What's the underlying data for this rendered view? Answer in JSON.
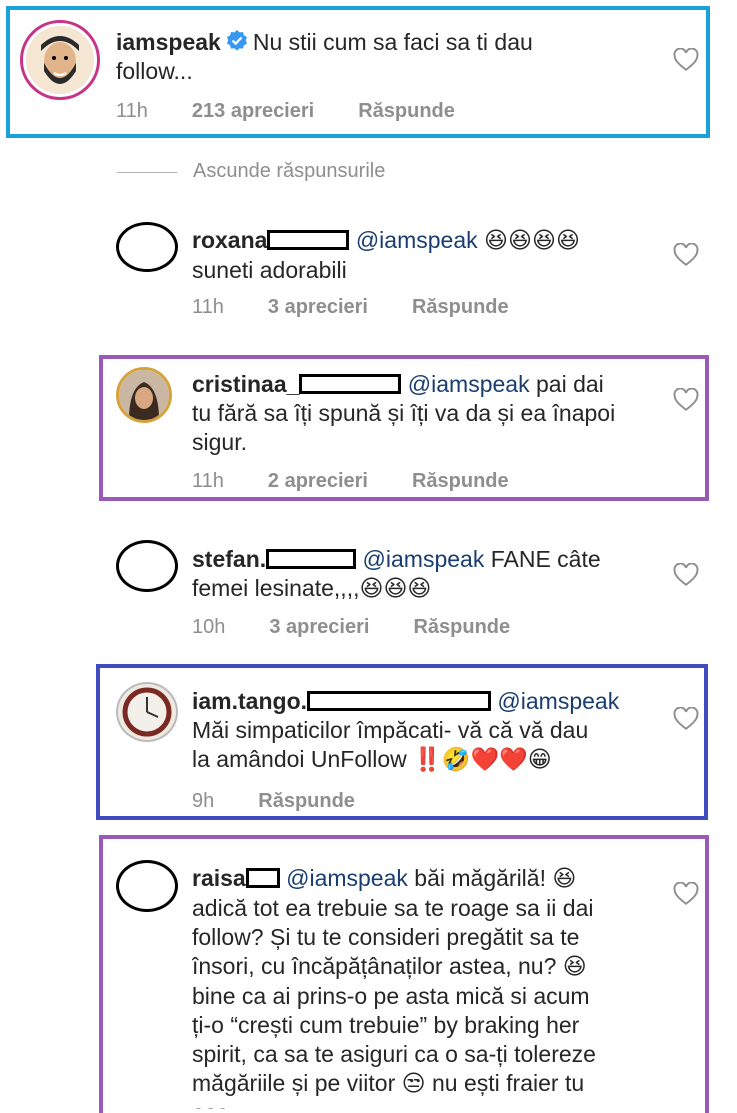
{
  "main_comment": {
    "username": "iamspeak",
    "text_line1": "Nu stii cum sa faci sa ti dau",
    "text_line2": "follow...",
    "time": "11h",
    "likes": "213 aprecieri",
    "reply_label": "Răspunde"
  },
  "hide_replies_label": "Ascunde răspunsurile",
  "replies": [
    {
      "username": "roxana",
      "mention": "@iamspeak",
      "line1_emoji": "😆😆😆😆",
      "line2": "suneti adorabili",
      "time": "11h",
      "likes": "3 aprecieri",
      "reply_label": "Răspunde"
    },
    {
      "username": "cristinaa_",
      "mention": "@iamspeak",
      "line1_text": "pai dai",
      "line2": "tu fără sa îți spună și îți va da și ea înapoi",
      "line3": "sigur.",
      "time": "11h",
      "likes": "2 aprecieri",
      "reply_label": "Răspunde"
    },
    {
      "username": "stefan.",
      "mention": "@iamspeak",
      "line1_text": "FANE câte",
      "line2": "femei lesinate,,,,",
      "line2_emoji": "😆😆😆",
      "time": "10h",
      "likes": "3 aprecieri",
      "reply_label": "Răspunde"
    },
    {
      "username": "iam.tango.",
      "mention": "@iamspeak",
      "line2": "Măi simpaticilor împăcati- vă că vă dau",
      "line3": "la amândoi UnFollow",
      "line3_emoji": "‼️🤣❤️❤️😁",
      "time": "9h",
      "reply_label": "Răspunde"
    },
    {
      "username": "raisa",
      "mention": "@iamspeak",
      "line1_text": "băi măgărilă!",
      "line1_emoji": "😆",
      "line2": "adică tot ea trebuie sa te roage sa ii dai",
      "line3": "follow? Și tu te consideri pregătit sa te",
      "line4": "însori, cu încăpățânaților astea, nu?",
      "line4_emoji": "😆",
      "line5": "bine ca ai prins-o pe asta mică si acum",
      "line6": "ți-o “crești cum trebuie” by braking her",
      "line7": "spirit, ca sa te asiguri ca o sa-ți tolereze",
      "line8": "măgăriile și pe viitor",
      "line8_emoji": "😒",
      "line8_tail": "nu ești fraier tu",
      "line9": "asa"
    }
  ],
  "colors": {
    "frame_blue_light": "#1ba0dc",
    "frame_purple": "#9b59b6",
    "frame_blue_dark": "#3f4bbf",
    "verified": "#3897f0",
    "meta_grey": "#8e8e8e"
  }
}
